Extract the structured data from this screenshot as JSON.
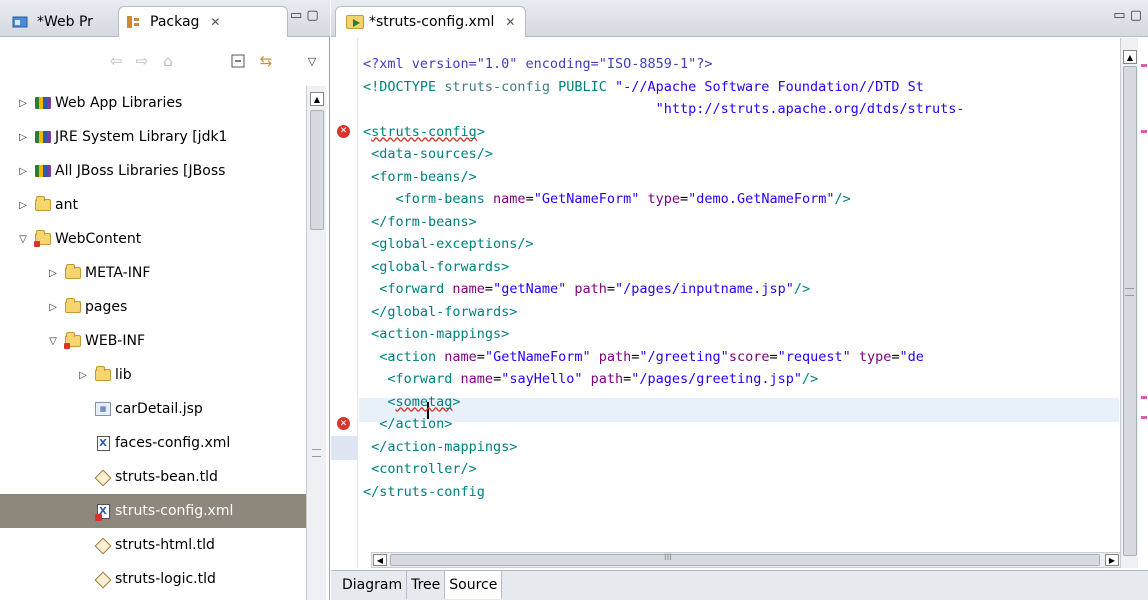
{
  "left_view": {
    "tabs": [
      {
        "label": "*Web Pr",
        "icon": "web-project-explorer-icon"
      },
      {
        "label": "Packag",
        "icon": "package-explorer-icon",
        "close": "✕"
      }
    ],
    "view_controls": "▭ ▢",
    "toolbar": [
      "back",
      "forward",
      "home",
      "collapse-all",
      "link-with-editor",
      "view-menu"
    ],
    "tree": [
      {
        "label": "Web App Libraries",
        "depth": 0,
        "twisty": "▷",
        "icon": "library-icon"
      },
      {
        "label": "JRE System Library [jdk1",
        "depth": 0,
        "twisty": "▷",
        "icon": "library-icon"
      },
      {
        "label": "All JBoss Libraries [JBoss",
        "depth": 0,
        "twisty": "▷",
        "icon": "library-icon"
      },
      {
        "label": "ant",
        "depth": 0,
        "twisty": "▷",
        "icon": "folder-icon"
      },
      {
        "label": "WebContent",
        "depth": 0,
        "twisty": "▽",
        "icon": "web-folder-icon"
      },
      {
        "label": "META-INF",
        "depth": 1,
        "twisty": "▷",
        "icon": "folder-icon"
      },
      {
        "label": "pages",
        "depth": 1,
        "twisty": "▷",
        "icon": "folder-icon"
      },
      {
        "label": "WEB-INF",
        "depth": 1,
        "twisty": "▽",
        "icon": "web-folder-icon"
      },
      {
        "label": "lib",
        "depth": 2,
        "twisty": "▷",
        "icon": "folder-icon"
      },
      {
        "label": "carDetail.jsp",
        "depth": 2,
        "twisty": "",
        "icon": "jsp-file-icon"
      },
      {
        "label": "faces-config.xml",
        "depth": 2,
        "twisty": "",
        "icon": "xml-file-icon"
      },
      {
        "label": "struts-bean.tld",
        "depth": 2,
        "twisty": "",
        "icon": "tld-file-icon"
      },
      {
        "label": "struts-config.xml",
        "depth": 2,
        "twisty": "",
        "icon": "xml-error-file-icon",
        "selected": true
      },
      {
        "label": "struts-html.tld",
        "depth": 2,
        "twisty": "",
        "icon": "tld-file-icon"
      },
      {
        "label": "struts-logic.tld",
        "depth": 2,
        "twisty": "",
        "icon": "tld-file-icon"
      }
    ]
  },
  "editor": {
    "tab_label": "*struts-config.xml",
    "tab_close": "✕",
    "view_controls": "▭ ▢",
    "lines": [
      {
        "html": "<span class='pi'>&lt;?xml version=\"1.0\" encoding=\"ISO-8859-1\"?&gt;</span>",
        "indent": 0
      },
      {
        "html": "<span class='dt'>&lt;!DOCTYPE </span><span class='tg'>struts-config</span><span class='dt'> PUBLIC </span><span class='vl'>\"-//Apache Software Foundation//DTD St</span>",
        "indent": 0
      },
      {
        "html": "<span class='vl'>                                    \"http://struts.apache.org/dtds/struts-</span>",
        "indent": 0
      },
      {
        "html": "<span class='ok'>&lt;<span class='sq'>struts-config</span>&gt;</span>",
        "indent": 0,
        "error": true
      },
      {
        "html": "<span class='ok'> &lt;data-sources/&gt;</span>",
        "indent": 0
      },
      {
        "html": "<span class='ok'> &lt;form-beans/&gt;</span>",
        "indent": 0
      },
      {
        "html": "<span class='ok'>    &lt;form-beans </span><span class='at'>name</span>=<span class='vl'>\"GetNameForm\"</span> <span class='at'>type</span>=<span class='vl'>\"demo.GetNameForm\"</span><span class='ok'>/&gt;</span>",
        "indent": 0
      },
      {
        "html": "<span class='ok'> &lt;/form-beans&gt;</span>",
        "indent": 0
      },
      {
        "html": "<span class='ok'> &lt;global-exceptions/&gt;</span>",
        "indent": 0
      },
      {
        "html": "<span class='ok'> &lt;global-forwards&gt;</span>",
        "indent": 0
      },
      {
        "html": "<span class='ok'>  &lt;forward </span><span class='at'>name</span>=<span class='vl'>\"getName\"</span> <span class='at'>path</span>=<span class='vl'>\"/pages/inputname.jsp\"</span><span class='ok'>/&gt;</span>",
        "indent": 0
      },
      {
        "html": "<span class='ok'> &lt;/global-forwards&gt;</span>",
        "indent": 0
      },
      {
        "html": "<span class='ok'> &lt;action-mappings&gt;</span>",
        "indent": 0
      },
      {
        "html": "<span class='ok'>  &lt;action </span><span class='at'>name</span>=<span class='vl'>\"GetNameForm\"</span> <span class='at'>path</span>=<span class='vl'>\"/greeting\"</span><span class='at'>score</span>=<span class='vl'>\"request\"</span> <span class='at'>type</span>=<span class='vl'>\"de</span>",
        "indent": 0
      },
      {
        "html": "<span class='ok'>   &lt;forward </span><span class='at'>name</span>=<span class='vl'>\"sayHello\"</span> <span class='at'>path</span>=<span class='vl'>\"/pages/greeting.jsp\"</span><span class='ok'>/&gt;</span>",
        "indent": 0
      },
      {
        "html": "<span class='ok'>   &lt;<span class='sq'>sometag</span>&gt;</span>",
        "indent": 0,
        "current": true
      },
      {
        "html": "<span class='ok'>  &lt;/action&gt;</span>",
        "indent": 0,
        "error": true
      },
      {
        "html": "<span class='ok'> &lt;/action-mappings&gt;</span>",
        "indent": 0
      },
      {
        "html": "<span class='ok'> &lt;controller/&gt;</span>",
        "indent": 0
      },
      {
        "html": "<span class='ok'>&lt;/struts-config</span>",
        "indent": 0
      }
    ],
    "page_tabs": [
      "Diagram",
      "Tree",
      "Source"
    ],
    "active_page_tab": "Source",
    "hscroll_mark": "III"
  },
  "colors": {
    "tag": "#008080",
    "attribute": "#7f007f",
    "value": "#2a00ff",
    "error": "#d9342b",
    "selection": "#8d877c"
  }
}
